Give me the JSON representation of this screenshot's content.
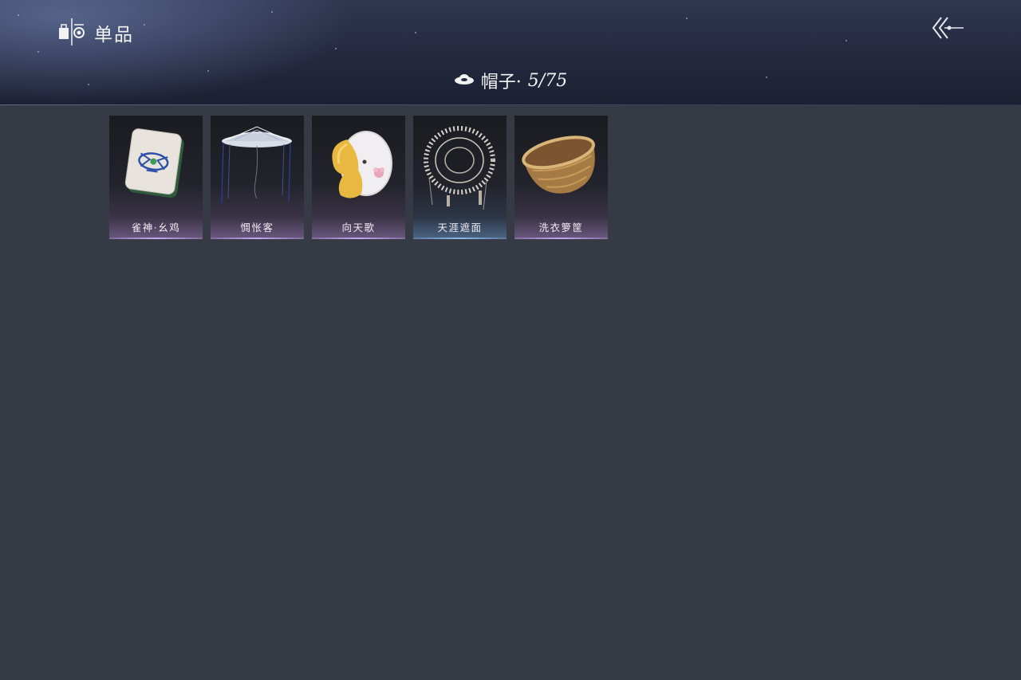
{
  "header": {
    "title": "单品",
    "title_icon": "wardrobe-icon",
    "back_icon": "double-chevron-back-icon"
  },
  "category": {
    "icon": "hat-icon",
    "label": "帽子·",
    "count": "5/75"
  },
  "items": [
    {
      "name": "雀神·幺鸡",
      "icon": "mahjong-tile-hat",
      "rarity_color": "#c8a6ee"
    },
    {
      "name": "惆怅客",
      "icon": "veiled-bamboo-hat",
      "rarity_color": "#c8a6ee"
    },
    {
      "name": "向天歌",
      "icon": "goose-hood-hat",
      "rarity_color": "#c8a6ee"
    },
    {
      "name": "天涯遮面",
      "icon": "frame-veil-hat",
      "rarity_color": "#8fb8e6"
    },
    {
      "name": "洗衣箩筐",
      "icon": "wicker-basket-hat",
      "rarity_color": "#c8a6ee"
    }
  ],
  "colors": {
    "background": "#363a44",
    "header": "#262b42",
    "purple_rarity": "#c8a6ee",
    "blue_rarity": "#8fb8e6"
  }
}
